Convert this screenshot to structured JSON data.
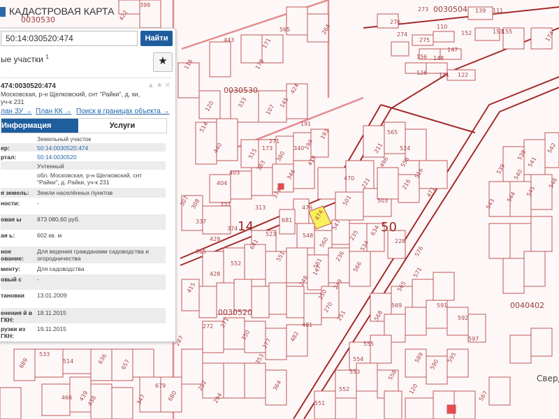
{
  "header": {
    "title": "КАДАСТРОВАЯ КАРТА"
  },
  "search": {
    "value": "50:14:030520:474",
    "button": "Найти"
  },
  "results": {
    "title": "ые участки",
    "count": "1",
    "star_icon": "star-icon"
  },
  "card": {
    "id": "474:0030520:474",
    "address": "Московская, р-н Щелковский, снт \"Райки\", д. ки, уч-к 231",
    "links": [
      "лан ЗУ →",
      "План КК →",
      "Поиск в границах объекта →"
    ],
    "tabs": {
      "info": "Информация",
      "services": "Услуги"
    },
    "rows": [
      {
        "k": "",
        "v": "Земельный участок"
      },
      {
        "k": "ер:",
        "v": "50:14:0030520:474",
        "link": true
      },
      {
        "k": "ртал:",
        "v": "50:14:0030520",
        "link": true
      },
      {
        "k": "",
        "v": "Учтенный"
      },
      {
        "k": "",
        "v": "обл. Московская, р-н Щелковский, снт \"Райки\", д. Райки, уч-к 231"
      },
      {
        "k": "я земель:",
        "v": "Земли населённых пунктов"
      },
      {
        "k": "ности:",
        "v": "-"
      },
      {
        "k": "овая ы",
        "v": "873 080,60 руб."
      },
      {
        "k": "ая ь:",
        "v": "602 кв. м"
      },
      {
        "k": "ное ование:",
        "v": "Для ведения гражданами садоводства и огородничества"
      },
      {
        "k": "менту:",
        "v": "Для садоводства"
      },
      {
        "k": "овый с",
        "v": "-"
      },
      {
        "k": "тановки",
        "v": "13.01.2009"
      },
      {
        "k": "енения й в ГКН:",
        "v": "18.11.2015"
      },
      {
        "k": "рузки из ГКН:",
        "v": "19.11.2015"
      }
    ]
  },
  "map": {
    "quarters": [
      "0030530",
      "0030504",
      "0030520",
      "0040402"
    ],
    "big_numbers": [
      "50",
      "14"
    ],
    "street": "Сверд",
    "selected_plot": "474",
    "selected_color": "#f7f05a",
    "line_color": "#c0565a"
  }
}
